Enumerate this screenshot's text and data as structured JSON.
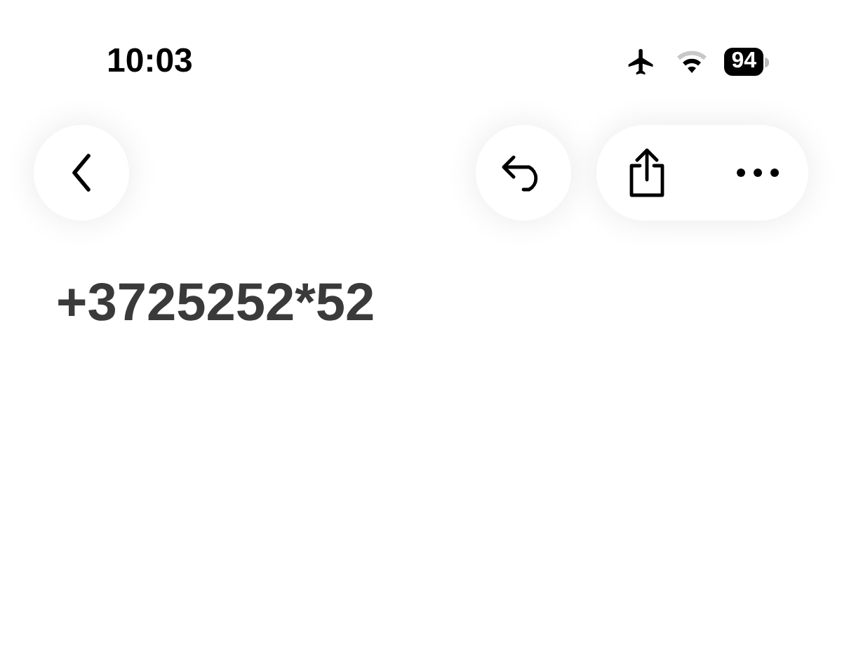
{
  "status_bar": {
    "time": "10:03",
    "battery": "94"
  },
  "title": "+3725252*52"
}
